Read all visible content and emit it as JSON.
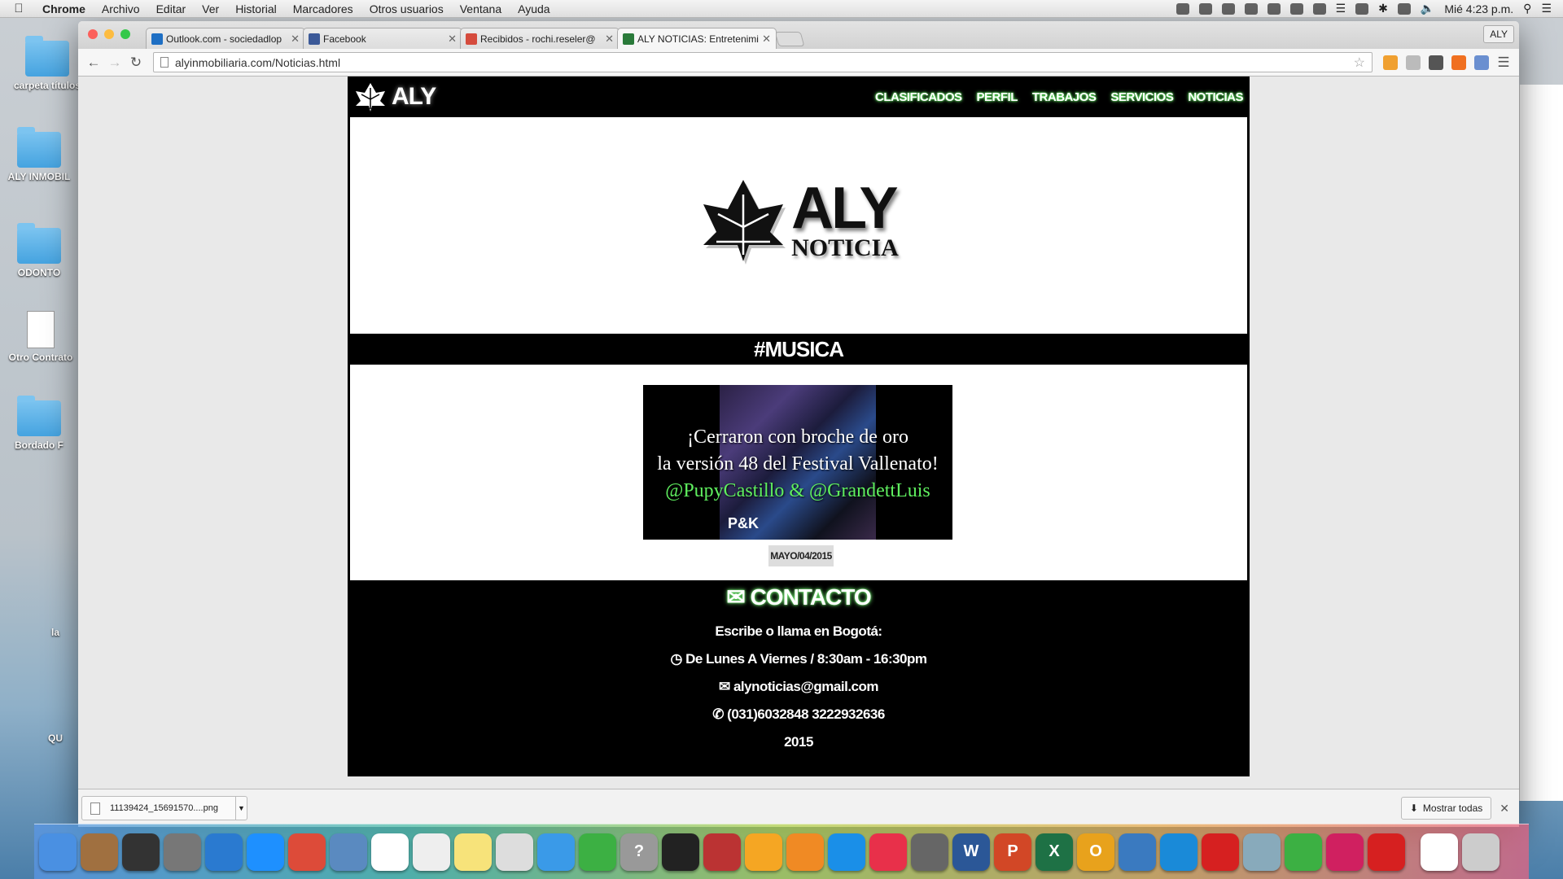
{
  "menubar": {
    "app_name": "Chrome",
    "items": [
      "Archivo",
      "Editar",
      "Ver",
      "Historial",
      "Marcadores",
      "Otros usuarios",
      "Ventana",
      "Ayuda"
    ],
    "clock": "Mié 4:23 p.m."
  },
  "desktop": {
    "items": [
      "carpeta títulos",
      "ALY INMOBIL",
      "ODONTO",
      "Otro Contrato",
      "Bordado F",
      "la",
      "QU"
    ]
  },
  "browser": {
    "tabs": [
      {
        "title": "Outlook.com - sociedadlop",
        "icon": "outlook-icon",
        "color": "#1e6fc4"
      },
      {
        "title": "Facebook",
        "icon": "facebook-icon",
        "color": "#3b5998"
      },
      {
        "title": "Recibidos - rochi.reseler@",
        "icon": "gmail-icon",
        "color": "#d54b3d"
      },
      {
        "title": "ALY NOTICIAS: Entretenimi",
        "icon": "aly-icon",
        "color": "#2a7a3a"
      }
    ],
    "profile": "ALY",
    "url": "alyinmobiliaria.com/Noticias.html"
  },
  "site": {
    "brand": "ALY",
    "nav": [
      "CLASIFICADOS",
      "PERFIL",
      "TRABAJOS",
      "SERVICIOS",
      "NOTICIAS"
    ],
    "hero": {
      "title": "ALY",
      "subtitle": "NOTICIA"
    },
    "section": "#MUSICA",
    "news": {
      "line1": "¡Cerraron con broche de oro",
      "line2": "la versión 48 del Festival Vallenato!",
      "line3": "@PupyCastillo & @GrandettLuis",
      "watermark": "P&K",
      "date": "MAYO/04/2015"
    },
    "contact": {
      "title": "CONTACTO",
      "intro": "Escribe o llama en Bogotá:",
      "hours": "De Lunes A Viernes / 8:30am - 16:30pm",
      "email": "alynoticias@gmail.com",
      "phone": "(031)6032848 3222932636",
      "year": "2015"
    }
  },
  "downloads": {
    "file": "11139424_15691570....png",
    "show_all": "Mostrar todas"
  },
  "colors": {
    "accent_glow": "#6cff6c",
    "site_bg": "#000000",
    "date_badge": "#dddddd"
  }
}
